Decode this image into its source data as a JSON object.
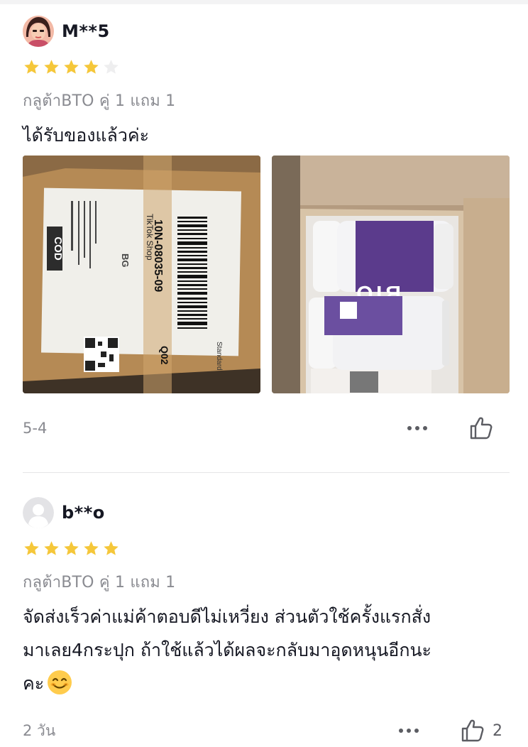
{
  "reviews": [
    {
      "username": "M**5",
      "rating": 4,
      "max_rating": 5,
      "variant": "กลูต้าBTO คู่ 1 แถม 1",
      "text": "ได้รับของแล้วค่ะ",
      "photos": [
        {
          "label": "COD",
          "shop": "TikTok Shop",
          "tracking": "10N-08035-09",
          "sort_code": "Q02",
          "service": "Standard",
          "tag": "BG"
        },
        {
          "product_label": "BTO"
        }
      ],
      "date": "5-4",
      "like_count": ""
    },
    {
      "username": "b**o",
      "rating": 5,
      "max_rating": 5,
      "variant": "กลูต้าBTO คู่ 1 แถม 1",
      "text_lines": [
        "จัดส่งเร็วค่าแม่ค้าตอบดีไม่เหวี่ยง ส่วนตัวใช้ครั้งแรกสั่ง",
        "มาเลย4กระปุก ถ้าใช้แล้วได้ผลจะกลับมาอุดหนุนอีกนะ",
        "คะ"
      ],
      "date": "2 วัน",
      "like_count": "2"
    }
  ],
  "icons": {
    "star_filled": "star-icon",
    "star_empty": "star-empty-icon",
    "more": "more-dots-icon",
    "like": "thumbs-up-icon",
    "emoji": "smiling-face-emoji"
  },
  "colors": {
    "star_filled": "#f5c73a",
    "star_empty": "#eeeeef",
    "muted_text": "#8a8b91",
    "primary_text": "#161823"
  }
}
